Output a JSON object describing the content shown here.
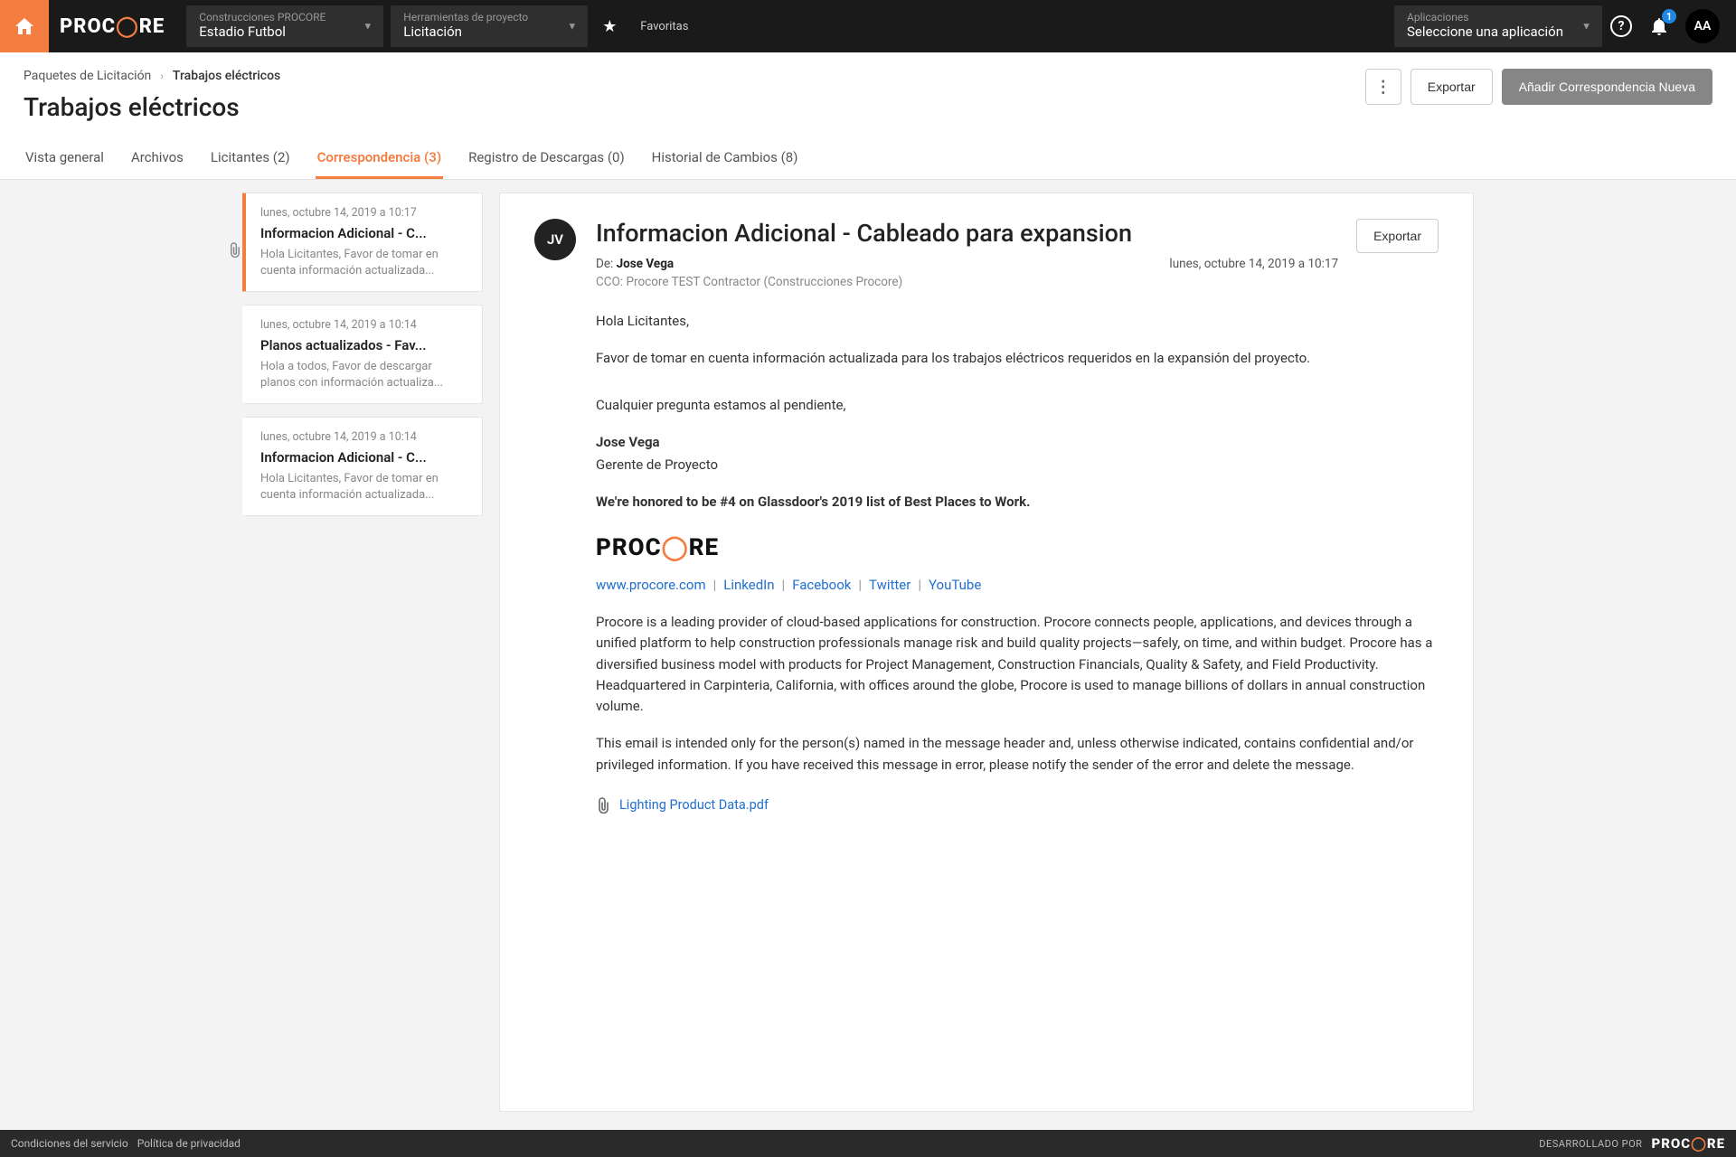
{
  "topbar": {
    "logo_pre": "PROC",
    "logo_post": "RE",
    "company_selector": {
      "label": "Construcciones PROCORE",
      "value": "Estadio Futbol"
    },
    "tool_selector": {
      "label": "Herramientas de proyecto",
      "value": "Licitación"
    },
    "favorites": "Favoritas",
    "apps_selector": {
      "label": "Aplicaciones",
      "value": "Seleccione una aplicación"
    },
    "help_glyph": "?",
    "notif_count": "1",
    "avatar": "AA"
  },
  "header": {
    "breadcrumb_root": "Paquetes de Licitación",
    "breadcrumb_current": "Trabajos eléctricos",
    "title": "Trabajos eléctricos",
    "actions": {
      "menu_dots": "⋮",
      "export": "Exportar",
      "add": "Añadir Correspondencia Nueva"
    }
  },
  "tabs": [
    {
      "label": "Vista general"
    },
    {
      "label": "Archivos"
    },
    {
      "label": "Licitantes (2)"
    },
    {
      "label": "Correspondencia (3)",
      "active": true
    },
    {
      "label": "Registro de Descargas (0)"
    },
    {
      "label": "Historial de Cambios (8)"
    }
  ],
  "messages": [
    {
      "date": "lunes, octubre 14, 2019 a 10:17",
      "subject": "Informacion Adicional - C...",
      "preview": "Hola Licitantes,    Favor de tomar en cuenta información actualizada...",
      "active": true,
      "has_attachment": true
    },
    {
      "date": "lunes, octubre 14, 2019 a 10:14",
      "subject": "Planos actualizados - Fav...",
      "preview": "Hola a todos,    Favor de descargar planos con información actualiza..."
    },
    {
      "date": "lunes, octubre 14, 2019 a 10:14",
      "subject": "Informacion Adicional - C...",
      "preview": "Hola Licitantes,    Favor de tomar en cuenta información actualizada..."
    }
  ],
  "detail": {
    "avatar": "JV",
    "title": "Informacion Adicional - Cableado para expansion",
    "from_label": "De: ",
    "from_name": "Jose Vega",
    "date": "lunes, octubre 14, 2019 a 10:17",
    "cco_label": "CCO: ",
    "cco_value": "Procore TEST Contractor (Construcciones Procore)",
    "export": "Exportar",
    "body": {
      "greeting": "Hola Licitantes,",
      "p1": "Favor de tomar en cuenta información actualizada para los trabajos eléctricos requeridos en la expansión del proyecto.",
      "p2": "Cualquier pregunta estamos al pendiente,",
      "sig_name": "Jose Vega",
      "sig_role": "Gerente de Proyecto",
      "honor": "We're honored to be #4 on Glassdoor's 2019 list of Best Places to Work.",
      "links": [
        "www.procore.com",
        "LinkedIn",
        "Facebook",
        "Twitter",
        "YouTube"
      ],
      "about": "Procore is a leading provider of cloud-based applications for construction. Procore connects people, applications, and devices through a unified platform to help construction professionals manage risk and build quality projects—safely, on time, and within budget. Procore has a diversified business model with products for Project Management, Construction Financials, Quality & Safety, and Field Productivity. Headquartered in Carpinteria, California, with offices around the globe, Procore is used to manage billions of dollars in annual construction volume.",
      "disclaimer": "This email is intended only for the person(s) named in the message header and, unless otherwise indicated, contains confidential and/or privileged information. If you have received this message in error, please notify the sender of the error and delete the message.",
      "attachment": "Lighting Product Data.pdf"
    }
  },
  "footer": {
    "terms": "Condiciones del servicio",
    "privacy": "Política de privacidad",
    "powered": "DESARROLLADO POR",
    "logo_pre": "PROC",
    "logo_post": "RE"
  }
}
